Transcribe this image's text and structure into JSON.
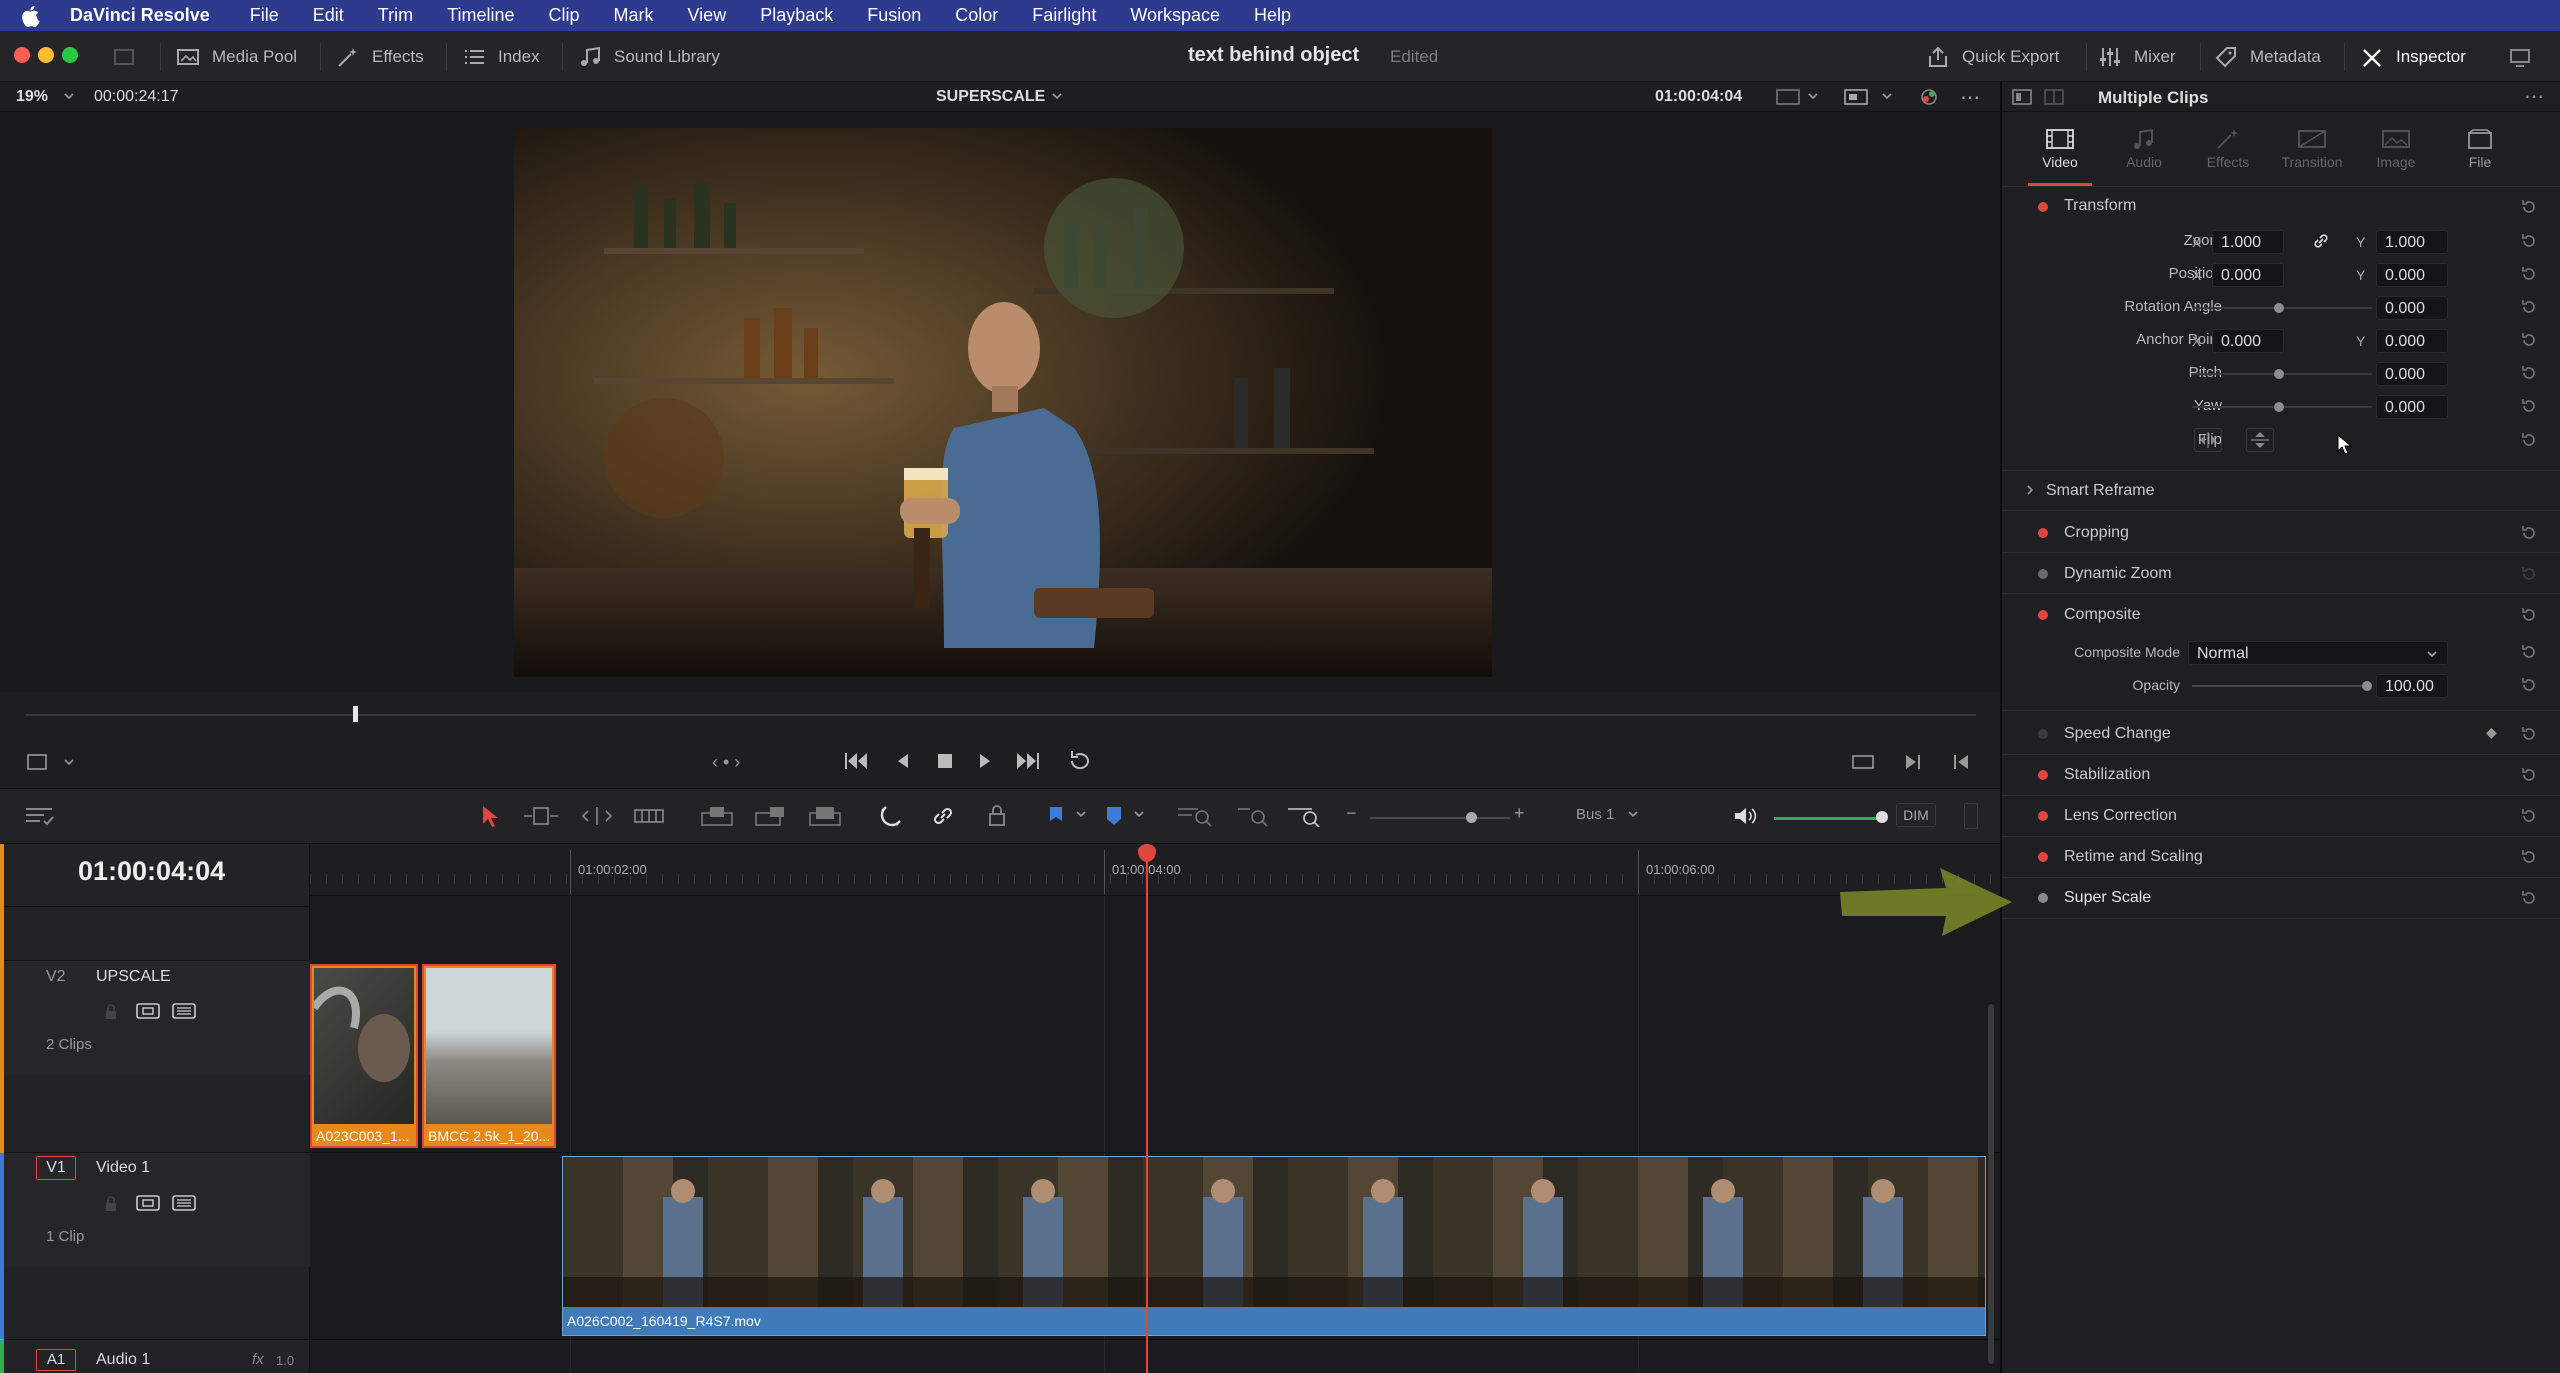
{
  "menubar": {
    "app_name": "DaVinci Resolve",
    "items": [
      "File",
      "Edit",
      "Trim",
      "Timeline",
      "Clip",
      "Mark",
      "View",
      "Playback",
      "Fusion",
      "Color",
      "Fairlight",
      "Workspace",
      "Help"
    ]
  },
  "toolbar": {
    "media_pool": "Media Pool",
    "effects": "Effects",
    "index": "Index",
    "sound_library": "Sound Library",
    "project_title": "text behind object",
    "project_status": "Edited",
    "quick_export": "Quick Export",
    "mixer": "Mixer",
    "metadata": "Metadata",
    "inspector": "Inspector"
  },
  "viewer": {
    "zoom": "19%",
    "duration": "00:00:24:17",
    "timeline_name": "SUPERSCALE",
    "timecode": "01:00:04:04"
  },
  "timeline": {
    "current_timecode": "01:00:04:04",
    "ruler": [
      "01:00:02:00",
      "01:00:04:00",
      "01:00:06:00"
    ],
    "audio_bus": "Bus 1",
    "dim": "DIM",
    "tracks": [
      {
        "id": "V2",
        "name": "UPSCALE",
        "count": "2 Clips"
      },
      {
        "id": "V1",
        "name": "Video 1",
        "count": "1 Clip"
      },
      {
        "id": "A1",
        "name": "Audio 1",
        "fx": "fx",
        "level": "1.0"
      }
    ],
    "clips": {
      "v2_clip1": "A023C003_1...",
      "v2_clip2": "BMCC 2.5k_1_20...",
      "v1_clip": "A026C002_160419_R4S7.mov"
    }
  },
  "inspector": {
    "header": "Multiple Clips",
    "tabs": [
      "Video",
      "Audio",
      "Effects",
      "Transition",
      "Image",
      "File"
    ],
    "transform": {
      "title": "Transform",
      "zoom_label": "Zoom",
      "zoom_x": "1.000",
      "zoom_y": "1.000",
      "position_label": "Position",
      "position_x": "0.000",
      "position_y": "0.000",
      "rotation_label": "Rotation Angle",
      "rotation": "0.000",
      "anchor_label": "Anchor Point",
      "anchor_x": "0.000",
      "anchor_y": "0.000",
      "pitch_label": "Pitch",
      "pitch": "0.000",
      "yaw_label": "Yaw",
      "yaw": "0.000",
      "flip_label": "Flip",
      "x": "X",
      "y": "Y"
    },
    "smart_reframe": "Smart Reframe",
    "cropping": "Cropping",
    "dynamic_zoom": "Dynamic Zoom",
    "composite": {
      "title": "Composite",
      "mode_label": "Composite Mode",
      "mode_value": "Normal",
      "opacity_label": "Opacity",
      "opacity_value": "100.00"
    },
    "speed_change": "Speed Change",
    "stabilization": "Stabilization",
    "lens_correction": "Lens Correction",
    "retime_scaling": "Retime and Scaling",
    "super_scale": "Super Scale"
  },
  "colors": {
    "accent_red": "#e0463c",
    "menubar_blue": "#2d3a8e",
    "clip_orange": "#e58a1a",
    "clip_blue": "#3f7bb8",
    "playhead": "#e0463c"
  }
}
